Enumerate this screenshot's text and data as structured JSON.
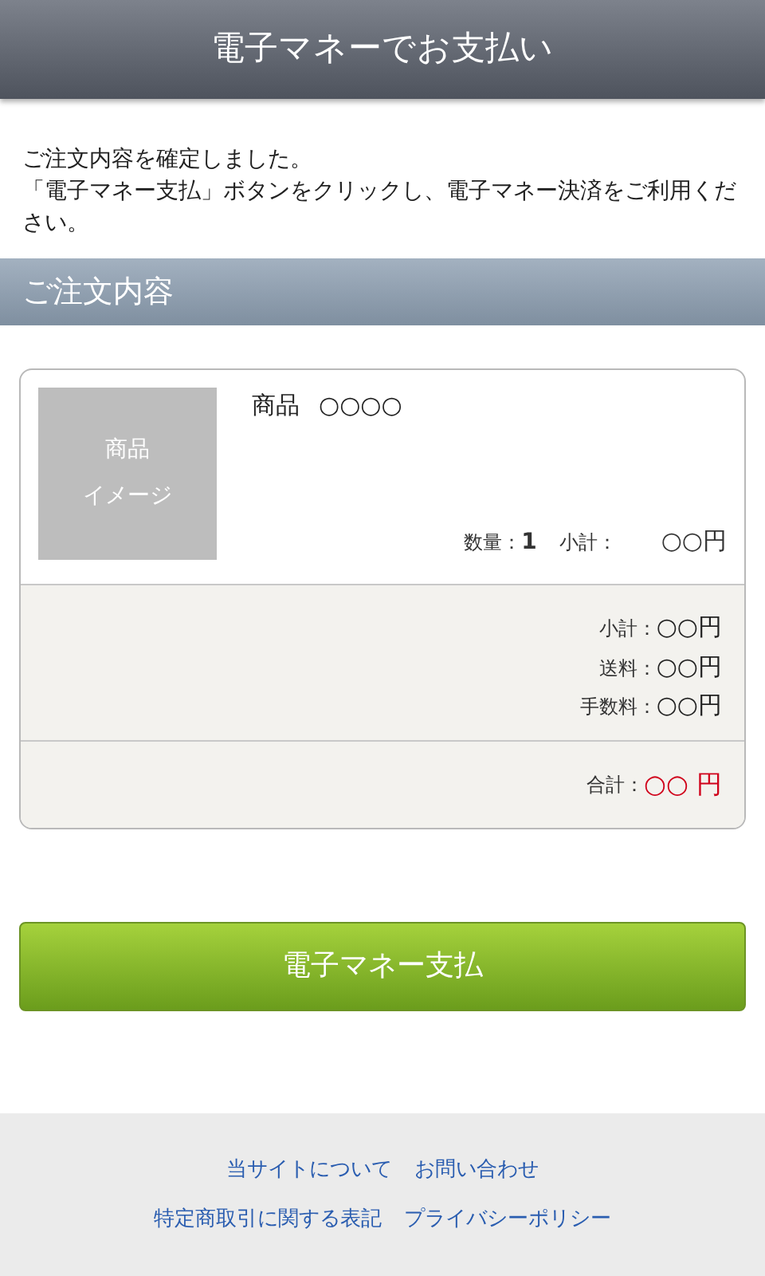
{
  "header": {
    "title": "電子マネーでお支払い"
  },
  "message": [
    "ご注文内容を確定しました。",
    "「電子マネー支払」ボタンをクリックし、電子マネー決済をご利用ください。"
  ],
  "section": {
    "title": "ご注文内容"
  },
  "order": {
    "image": [
      "商品",
      "イメージ"
    ],
    "product": {
      "label": "商品",
      "name": "○○○○"
    },
    "quantity": {
      "label": "数量：",
      "value": "1"
    },
    "item_subtotal": {
      "label": "小計：",
      "value": "○○円"
    },
    "summary": [
      {
        "label": "小計：",
        "value": "○○円"
      },
      {
        "label": "送料：",
        "value": "○○円"
      },
      {
        "label": "手数料：",
        "value": "○○円"
      }
    ],
    "total": {
      "label": "合計：",
      "value": "○○ 円"
    }
  },
  "pay_button": "電子マネー支払",
  "footer": {
    "links": [
      [
        "当サイトについて",
        "お問い合わせ"
      ],
      [
        "特定商取引に関する表記",
        "プライバシーポリシー"
      ]
    ]
  }
}
